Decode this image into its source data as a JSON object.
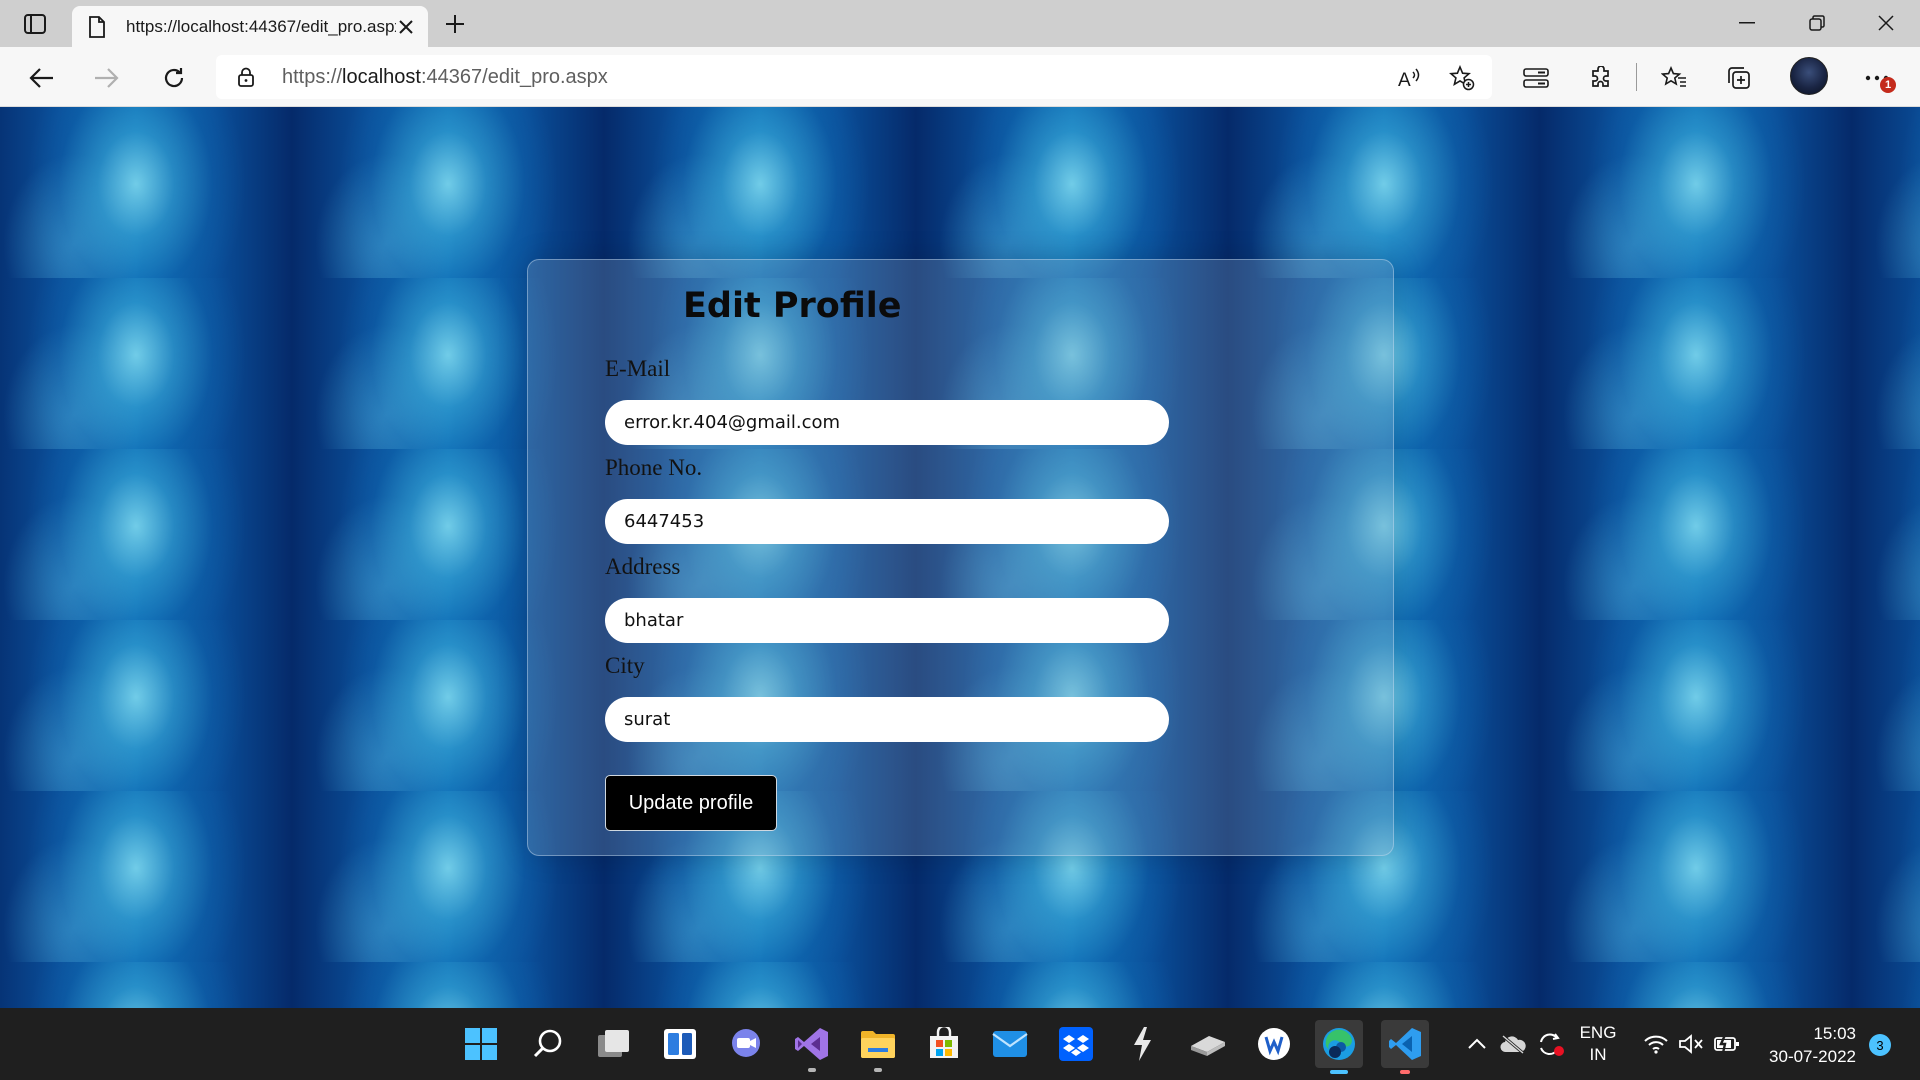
{
  "browser": {
    "tab_title": "https://localhost:44367/edit_pro.aspx",
    "url_prefix": "https://",
    "url_host": "localhost",
    "url_rest": ":44367/edit_pro.aspx",
    "notification_count": "1"
  },
  "form": {
    "title": "Edit Profile",
    "email_label": "E-Mail",
    "email_value": "error.kr.404@gmail.com",
    "phone_label": "Phone No.",
    "phone_value": "6447453",
    "address_label": "Address",
    "address_value": "bhatar",
    "city_label": "City",
    "city_value": "surat",
    "submit_label": "Update profile"
  },
  "taskbar": {
    "apps": [
      "start",
      "search",
      "task-view",
      "widgets",
      "teams-chat",
      "visual-studio",
      "file-explorer",
      "microsoft-store",
      "mail",
      "dropbox",
      "bolt-app",
      "drive-app",
      "wps-app",
      "edge",
      "vscode"
    ],
    "language_line1": "ENG",
    "language_line2": "IN",
    "time": "15:03",
    "date": "30-07-2022",
    "notification_count": "3"
  },
  "colors": {
    "page_bg": "#08306a",
    "button_bg": "#000000",
    "taskbar_bg": "#1f1f1f",
    "accent": "#4cc2ff"
  }
}
